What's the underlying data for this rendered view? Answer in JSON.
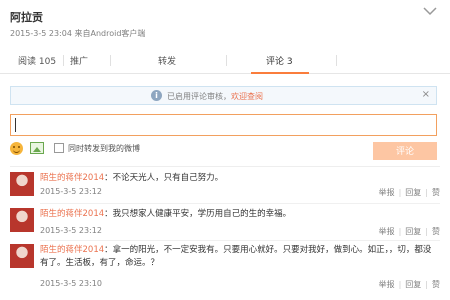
{
  "post": {
    "author": "阿拉贡",
    "time": "2015-3-5 23:04",
    "source_prefix": "来自",
    "source": "Android客户端"
  },
  "tabs": [
    {
      "label": "阅读 105"
    },
    {
      "label": "推广"
    },
    {
      "label": "转发"
    },
    {
      "label": "评论 3"
    }
  ],
  "notice": {
    "icon": "i",
    "text": "已启用评论审核，",
    "link": "欢迎查阅",
    "close": "×"
  },
  "comment_box": {
    "value": "",
    "placeholder": "",
    "also_repost_label": "同时转发到我的微博",
    "submit_label": "评论"
  },
  "comments": [
    {
      "user": "陌生的蒋伴2014",
      "text": "：不论天光人，只有自己努力。",
      "time": "2015-3-5 23:12",
      "actions": [
        "举报",
        "回复",
        "赞"
      ]
    },
    {
      "user": "陌生的蒋伴2014",
      "text": "：我只想家人健康平安，学历用自己的生的幸福。",
      "time": "2015-3-5 23:12",
      "actions": [
        "举报",
        "回复",
        "赞"
      ]
    },
    {
      "user": "陌生的蒋伴2014",
      "text": "：拿一的阳光，不一定安我有。只要用心就好。只要对我好，做到心。如正，，切，都没有了。生活板，有了，命运。？",
      "time": "2015-3-5 23:10",
      "actions": [
        "举报",
        "回复",
        "赞"
      ]
    }
  ],
  "colors": {
    "accent": "#eb7350",
    "input_border": "#f2a05f",
    "submit_bg": "#fdc6a3",
    "notice_bg": "#f4f8fc"
  }
}
